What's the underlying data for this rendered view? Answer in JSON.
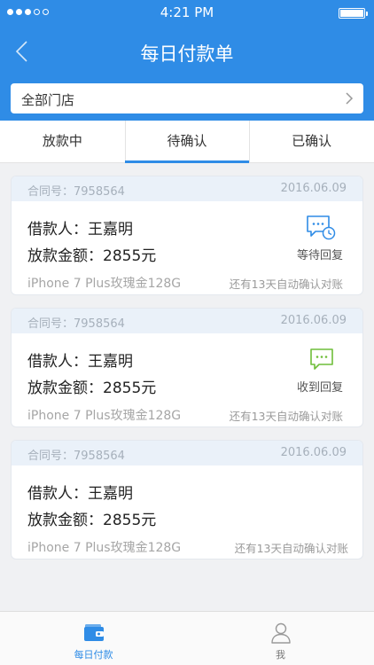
{
  "status_bar": {
    "time": "4:21 PM"
  },
  "nav": {
    "title": "每日付款单"
  },
  "store_selector": {
    "label": "全部门店"
  },
  "tabs": [
    {
      "label": "放款中",
      "active": false
    },
    {
      "label": "待确认",
      "active": true
    },
    {
      "label": "已确认",
      "active": false
    }
  ],
  "cards": [
    {
      "contract": "合同号：7958564",
      "date": "2016.06.09",
      "borrower": "借款人：王嘉明",
      "amount": "放款金额：2855元",
      "product": "iPhone 7 Plus玫瑰金128G",
      "note": "还有13天自动确认对账",
      "status_icon": "chat-clock-icon",
      "status_icon_color": "#2f8ce6",
      "status": "等待回复"
    },
    {
      "contract": "合同号：7958564",
      "date": "2016.06.09",
      "borrower": "借款人：王嘉明",
      "amount": "放款金额：2855元",
      "product": "iPhone 7 Plus玫瑰金128G",
      "note": "还有13天自动确认对账",
      "status_icon": "chat-icon",
      "status_icon_color": "#6fbe3a",
      "status": "收到回复"
    },
    {
      "contract": "合同号：7958564",
      "date": "2016.06.09",
      "borrower": "借款人：王嘉明",
      "amount": "放款金额：2855元",
      "product": "iPhone 7 Plus玫瑰金128G",
      "note": "还有13天自动确认对账"
    }
  ],
  "tabbar": [
    {
      "label": "每日付款",
      "icon": "wallet-icon",
      "active": true
    },
    {
      "label": "我",
      "icon": "person-icon",
      "active": false
    }
  ],
  "colors": {
    "accent": "#2f8ce6",
    "success": "#6fbe3a"
  }
}
